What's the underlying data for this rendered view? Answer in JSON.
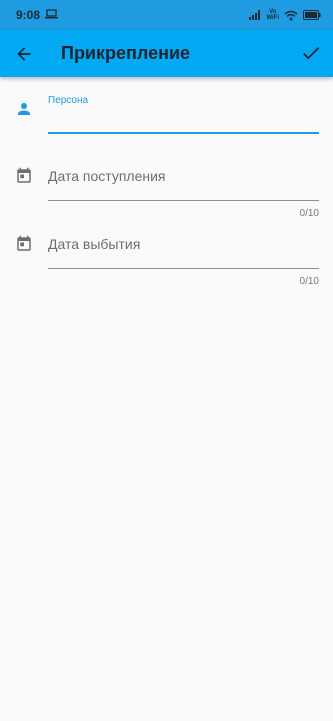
{
  "status_bar": {
    "time": "9:08",
    "volte_top": "Vo",
    "volte_bottom": "WiFi"
  },
  "app_bar": {
    "title": "Прикрепление"
  },
  "form": {
    "person": {
      "label": "Персона",
      "value": ""
    },
    "arrival_date": {
      "hint": "Дата поступления",
      "counter": "0/10"
    },
    "departure_date": {
      "hint": "Дата выбытия",
      "counter": "0/10"
    }
  },
  "colors": {
    "status_bar": "#1e9be1",
    "app_bar": "#04a9f4",
    "accent": "#1e9be1",
    "background": "#fafafa"
  }
}
